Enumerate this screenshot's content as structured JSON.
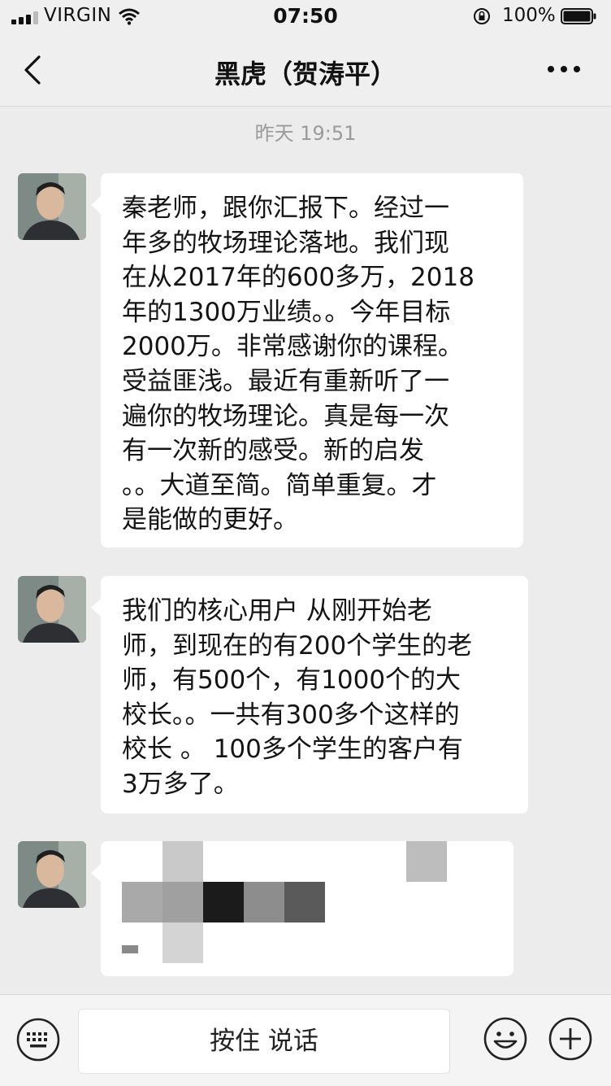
{
  "status_bar": {
    "carrier": "VIRGIN",
    "time": "07:50",
    "battery": "100%"
  },
  "nav": {
    "title": "黑虎（贺涛平）"
  },
  "chat": {
    "timestamp": "昨天 19:51",
    "messages": [
      {
        "text": "秦老师，跟你汇报下。经过一\n年多的牧场理论落地。我们现\n在从2017年的600多万，2018\n年的1300万业绩。。今年目标\n2000万。非常感谢你的课程。\n受益匪浅。最近有重新听了一\n遍你的牧场理论。真是每一次\n有一次新的感受。新的启发\n。。大道至简。简单重复。才\n是能做的更好。"
      },
      {
        "text": "我们的核心用户 从刚开始老\n师，到现在的有200个学生的老\n师，有500个，有1000个的大\n校长。。一共有300多个这样的\n校长 。 100多个学生的客户有\n3万多了。"
      }
    ]
  },
  "input_bar": {
    "hold_to_talk": "按住 说话"
  },
  "icons": [
    "signal-icon",
    "wifi-icon",
    "rotation-lock-icon",
    "battery-icon",
    "back-arrow-icon",
    "more-icon",
    "keyboard-icon",
    "emoji-icon",
    "plus-icon"
  ]
}
